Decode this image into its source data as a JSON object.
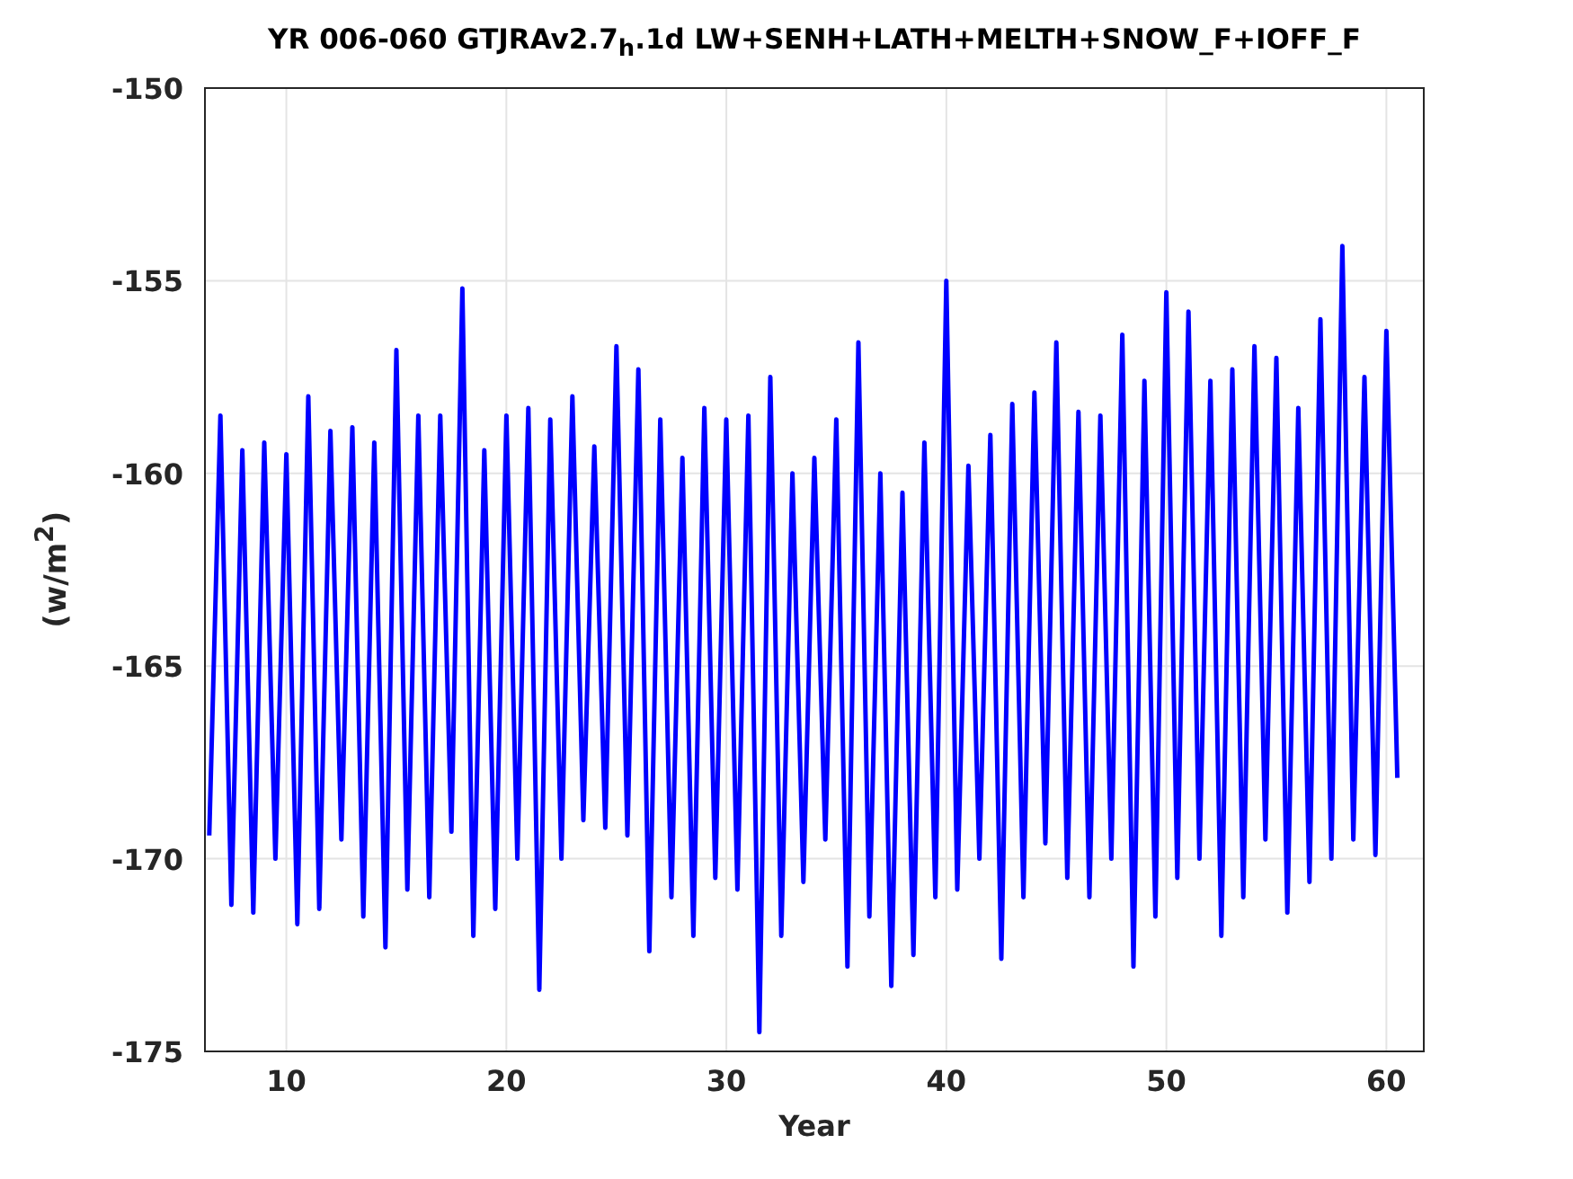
{
  "figure": {
    "title": "YR 006-060 GTJRAv2.7$_{h}$.1d LW+SENH+LATH+MELTH+SNOW_F+IOFF_F",
    "chart_data": {
      "type": "line",
      "grid": true,
      "xlabel": "Year",
      "ylabel": "(w/m$^{2}$)",
      "xlim": [
        6.3,
        61.7
      ],
      "ylim": [
        -175,
        -150
      ],
      "xticks": [
        10,
        20,
        30,
        40,
        50,
        60
      ],
      "yticks": [
        -175,
        -170,
        -165,
        -160,
        -155,
        -150
      ],
      "x": [
        6.5,
        7,
        7.5,
        8,
        8.5,
        9,
        9.5,
        10,
        10.5,
        11,
        11.5,
        12,
        12.5,
        13,
        13.5,
        14,
        14.5,
        15,
        15.5,
        16,
        16.5,
        17,
        17.5,
        18,
        18.5,
        19,
        19.5,
        20,
        20.5,
        21,
        21.5,
        22,
        22.5,
        23,
        23.5,
        24,
        24.5,
        25,
        25.5,
        26,
        26.5,
        27,
        27.5,
        28,
        28.5,
        29,
        29.5,
        30,
        30.5,
        31,
        31.5,
        32,
        32.5,
        33,
        33.5,
        34,
        34.5,
        35,
        35.5,
        36,
        36.5,
        37,
        37.5,
        38,
        38.5,
        39,
        39.5,
        40,
        40.5,
        41,
        41.5,
        42,
        42.5,
        43,
        43.5,
        44,
        44.5,
        45,
        45.5,
        46,
        46.5,
        47,
        47.5,
        48,
        48.5,
        49,
        49.5,
        50,
        50.5,
        51,
        51.5,
        52,
        52.5,
        53,
        53.5,
        54,
        54.5,
        55,
        55.5,
        56,
        56.5,
        57,
        57.5,
        58,
        58.5,
        59,
        59.5,
        60,
        60.5
      ],
      "series": [
        {
          "color": "#0000ff",
          "values": [
            -169.4,
            -158.5,
            -171.2,
            -159.4,
            -171.4,
            -159.2,
            -170,
            -159.5,
            -171.7,
            -158,
            -171.3,
            -158.9,
            -169.5,
            -158.8,
            -171.5,
            -159.2,
            -172.3,
            -156.8,
            -170.8,
            -158.5,
            -171,
            -158.5,
            -169.3,
            -155.2,
            -172,
            -159.4,
            -171.3,
            -158.5,
            -170,
            -158.3,
            -173.4,
            -158.6,
            -170,
            -158,
            -169,
            -159.3,
            -169.2,
            -156.7,
            -169.4,
            -157.3,
            -172.4,
            -158.6,
            -171,
            -159.6,
            -172,
            -158.3,
            -170.5,
            -158.6,
            -170.8,
            -158.5,
            -174.5,
            -157.5,
            -172,
            -160,
            -170.6,
            -159.6,
            -169.5,
            -158.6,
            -172.8,
            -156.6,
            -171.5,
            -160,
            -173.3,
            -160.5,
            -172.5,
            -159.2,
            -171,
            -155,
            -170.8,
            -159.8,
            -170,
            -159,
            -172.6,
            -158.2,
            -171,
            -157.9,
            -169.6,
            -156.6,
            -170.5,
            -158.4,
            -171,
            -158.5,
            -170,
            -156.4,
            -172.8,
            -157.6,
            -171.5,
            -155.3,
            -170.5,
            -155.8,
            -170,
            -157.6,
            -172,
            -157.3,
            -171,
            -156.7,
            -169.5,
            -157,
            -171.4,
            -158.3,
            -170.6,
            -156,
            -170,
            -154.1,
            -169.5,
            -157.5,
            -169.9,
            -156.3,
            -167.9
          ]
        }
      ]
    }
  }
}
